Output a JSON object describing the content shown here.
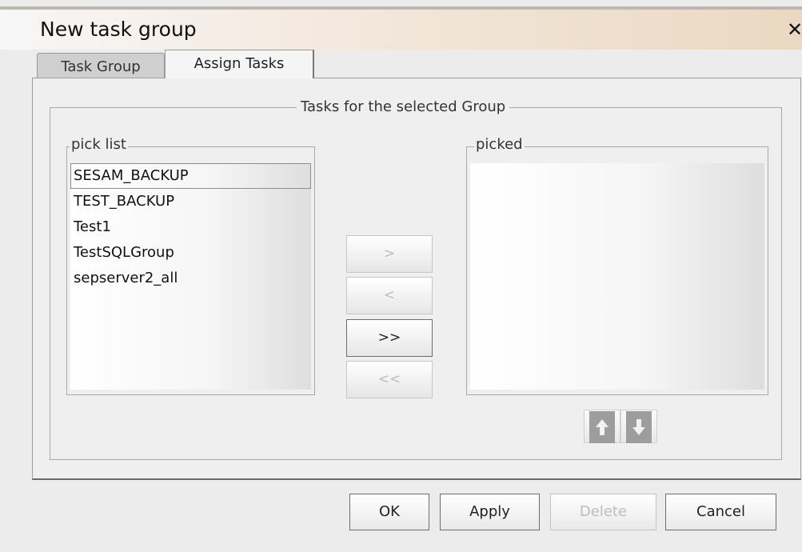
{
  "window": {
    "title": "New task group",
    "close_symbol": "✕"
  },
  "tabs": [
    {
      "label": "Task Group",
      "active": false
    },
    {
      "label": "Assign Tasks",
      "active": true
    }
  ],
  "group_title": "Tasks for the selected Group",
  "pick_list": {
    "label": "pick list",
    "items": [
      "SESAM_BACKUP",
      "TEST_BACKUP",
      "Test1",
      "TestSQLGroup",
      "sepserver2_all"
    ],
    "selected_index": 0
  },
  "picked": {
    "label": "picked",
    "items": []
  },
  "move_buttons": {
    "add": ">",
    "remove": "<",
    "add_all": ">>",
    "remove_all": "<<"
  },
  "order_buttons": {
    "up_icon": "arrow-up-icon",
    "down_icon": "arrow-down-icon"
  },
  "footer": {
    "ok": "OK",
    "apply": "Apply",
    "delete": "Delete",
    "cancel": "Cancel"
  }
}
